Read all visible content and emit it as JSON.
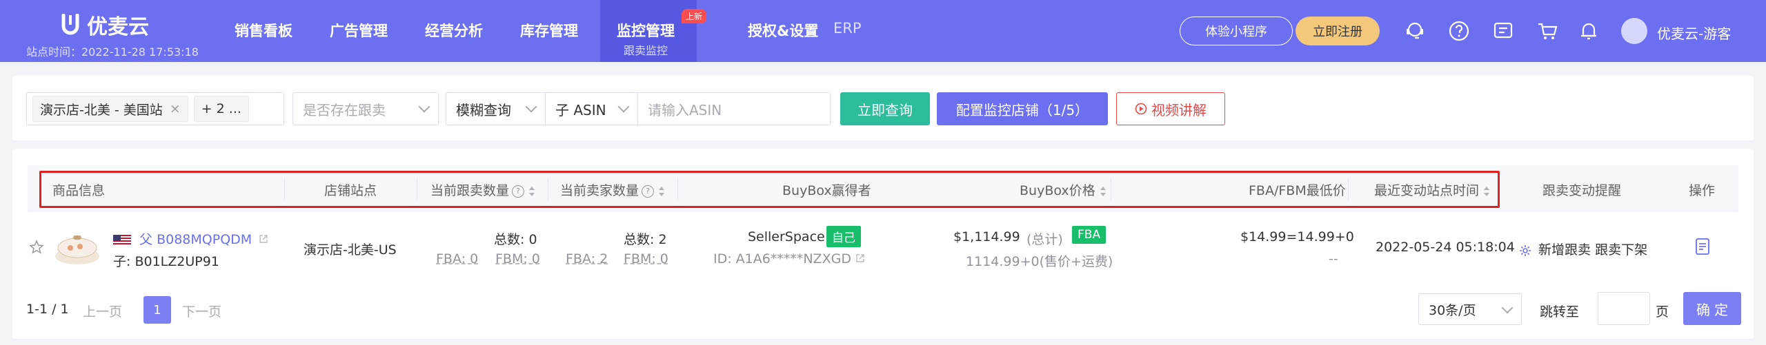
{
  "app": {
    "brand": "优麦云",
    "site_time": "站点时间：2022-11-28 17:53:18",
    "nav": [
      "销售看板",
      "广告管理",
      "经营分析",
      "库存管理"
    ],
    "nav_active": {
      "label": "监控管理",
      "sub": "跟卖监控",
      "badge": "上新"
    },
    "nav_more": [
      "授权&设置",
      "ERP"
    ],
    "btn_mini": "体验小程序",
    "btn_register": "立即注册",
    "user": "优麦云-游客"
  },
  "filters": {
    "store_tag": "演示店-北美 - 美国站",
    "store_more": "+ 2 ...",
    "follow_placeholder": "是否存在跟卖",
    "match_mode": "模糊查询",
    "asin_type": "子 ASIN",
    "asin_placeholder": "请输入ASIN",
    "btn_query": "立即查询",
    "btn_config": "配置监控店铺（1/5）",
    "btn_video": "视频讲解"
  },
  "table": {
    "headers": [
      "商品信息",
      "店铺站点",
      "当前跟卖数量",
      "当前卖家数量",
      "BuyBox赢得者",
      "BuyBox价格",
      "FBA/FBM最低价",
      "最近变动站点时间",
      "跟卖变动提醒",
      "操作"
    ],
    "row": {
      "parent_asin": "父 B088MQPQDM",
      "child_asin": "子: B01LZ2UP91",
      "store": "演示店-北美-US",
      "follow_total": "总数:  0",
      "follow_fba": "FBA:  0",
      "follow_fbm": "FBM:  0",
      "seller_total": "总数:  2",
      "seller_fba": "FBA:  2",
      "seller_fbm": "FBM:  0",
      "buybox_winner": "SellerSpace",
      "winner_tag": "自己",
      "winner_id": "ID:  A1A6*****NZXGD",
      "buybox_price": "$1,114.99",
      "price_total": "(总计)",
      "price_tag": "FBA",
      "price_detail": "1114.99+0(售价+运费)",
      "lowest": "$14.99=14.99+0",
      "lowest_sub": "--",
      "changed_time": "2022-05-24 05:18:04",
      "reminder": "新增跟卖  跟卖下架"
    }
  },
  "pagination": {
    "range": "1-1 / 1",
    "prev": "上一页",
    "current": "1",
    "next": "下一页",
    "page_size": "30条/页",
    "goto": "跳转至",
    "page_unit": "页",
    "confirm": "确 定"
  },
  "colors": {
    "primary": "#6b6ff0",
    "success": "#2ebd9b",
    "danger": "#e02020"
  }
}
